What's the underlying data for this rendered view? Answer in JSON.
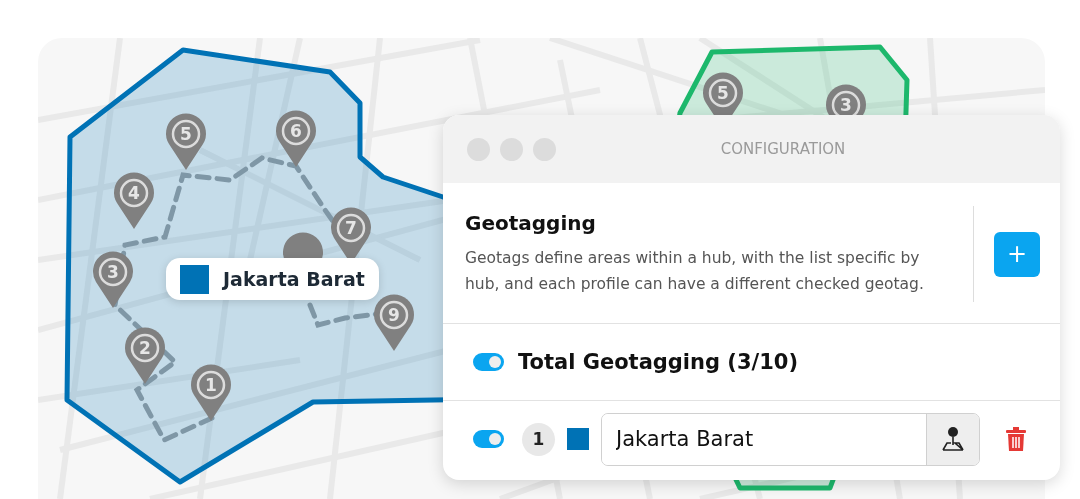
{
  "map": {
    "areas": [
      {
        "color": "#0072b5",
        "label": "Jakarta Barat",
        "pins": [
          {
            "label": "1"
          },
          {
            "label": "2"
          },
          {
            "label": "3"
          },
          {
            "label": "4"
          },
          {
            "label": "5"
          },
          {
            "label": "6"
          },
          {
            "label": "7"
          },
          {
            "label": "9"
          }
        ]
      },
      {
        "color": "#1db86c",
        "pins": [
          {
            "label": "5"
          },
          {
            "label": "3"
          }
        ]
      }
    ]
  },
  "window": {
    "title": "CONFIGURATION"
  },
  "section": {
    "heading": "Geotagging",
    "description": "Geotags define areas within a hub, with the list specific by hub, and each profile can have a different checked geotag.",
    "add_button": "+"
  },
  "total": {
    "on": true,
    "label": "Total Geotagging (3/10)"
  },
  "geotags": [
    {
      "on": true,
      "number": "1",
      "color": "#0072b5",
      "value": "Jakarta Barat"
    }
  ]
}
